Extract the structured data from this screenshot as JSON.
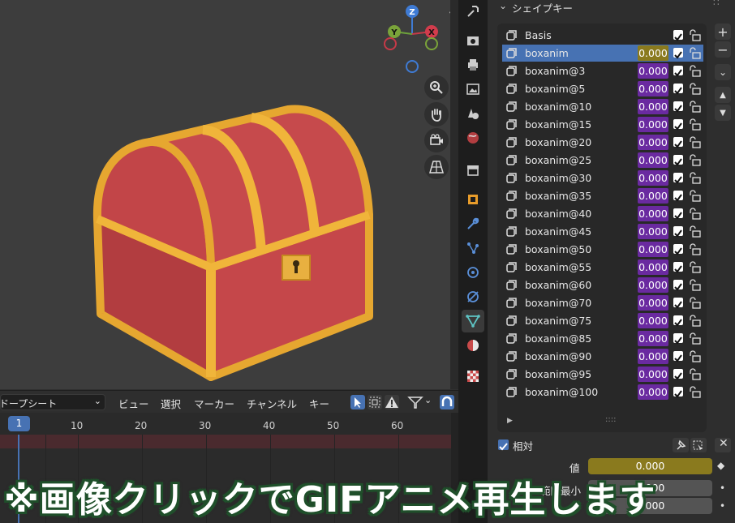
{
  "shape_keys_panel": {
    "title": "シェイプキー",
    "keys": [
      {
        "name": "Basis",
        "value": "",
        "selected": false
      },
      {
        "name": "boxanim",
        "value": "0.000",
        "selected": true
      },
      {
        "name": "boxanim@3",
        "value": "0.000",
        "selected": false
      },
      {
        "name": "boxanim@5",
        "value": "0.000",
        "selected": false
      },
      {
        "name": "boxanim@10",
        "value": "0.000",
        "selected": false
      },
      {
        "name": "boxanim@15",
        "value": "0.000",
        "selected": false
      },
      {
        "name": "boxanim@20",
        "value": "0.000",
        "selected": false
      },
      {
        "name": "boxanim@25",
        "value": "0.000",
        "selected": false
      },
      {
        "name": "boxanim@30",
        "value": "0.000",
        "selected": false
      },
      {
        "name": "boxanim@35",
        "value": "0.000",
        "selected": false
      },
      {
        "name": "boxanim@40",
        "value": "0.000",
        "selected": false
      },
      {
        "name": "boxanim@45",
        "value": "0.000",
        "selected": false
      },
      {
        "name": "boxanim@50",
        "value": "0.000",
        "selected": false
      },
      {
        "name": "boxanim@55",
        "value": "0.000",
        "selected": false
      },
      {
        "name": "boxanim@60",
        "value": "0.000",
        "selected": false
      },
      {
        "name": "boxanim@70",
        "value": "0.000",
        "selected": false
      },
      {
        "name": "boxanim@75",
        "value": "0.000",
        "selected": false
      },
      {
        "name": "boxanim@85",
        "value": "0.000",
        "selected": false
      },
      {
        "name": "boxanim@90",
        "value": "0.000",
        "selected": false
      },
      {
        "name": "boxanim@95",
        "value": "0.000",
        "selected": false
      },
      {
        "name": "boxanim@100",
        "value": "0.000",
        "selected": false
      }
    ],
    "relative_label": "相対",
    "value_label": "値",
    "value": "0.000",
    "range_min_label": "範囲最小",
    "range_min": "0.000",
    "range_max": "1.000"
  },
  "timeline": {
    "editor_type": "ドープシート",
    "menus": [
      "ビュー",
      "選択",
      "マーカー",
      "チャンネル",
      "キー"
    ],
    "current_frame": "1",
    "ticks": [
      "10",
      "20",
      "30",
      "40",
      "50",
      "60"
    ]
  },
  "gizmo": {
    "z": "Z",
    "y": "Y",
    "x": "X"
  },
  "overlay_caption": "※画像クリックでGIFアニメ再生します",
  "colors": {
    "selected_row": "#4772b3",
    "value_field": "#6a2aa0",
    "selected_value": "#8a7a1e",
    "chest_red": "#c94a4a",
    "chest_gold": "#e8a832",
    "caption_outline": "#1f4f2a"
  }
}
